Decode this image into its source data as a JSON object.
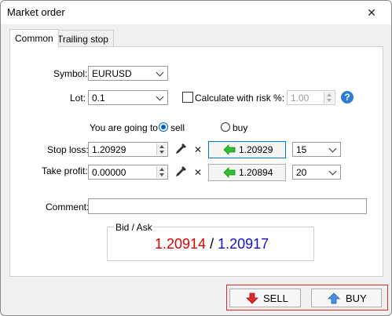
{
  "window": {
    "title": "Market order",
    "close_symbol": "✕"
  },
  "tabs": [
    {
      "label": "Common",
      "active": true
    },
    {
      "label": "Trailing stop",
      "active": false
    }
  ],
  "form": {
    "symbol": {
      "label": "Symbol:",
      "value": "EURUSD"
    },
    "lot": {
      "label": "Lot:",
      "value": "0.1"
    },
    "risk": {
      "label": "Calculate with risk %:",
      "checked": false,
      "value": "1.00",
      "help": "?"
    },
    "direction": {
      "label": "You are going to",
      "options": [
        {
          "label": "sell",
          "selected": true
        },
        {
          "label": "buy",
          "selected": false
        }
      ]
    },
    "stop_loss": {
      "label": "Stop loss:",
      "value": "1.20929",
      "clear": "✕",
      "price_button": "1.20929",
      "points": "15"
    },
    "take_profit": {
      "label": "Take profit:",
      "value": "0.00000",
      "clear": "✕",
      "price_button": "1.20894",
      "points": "20"
    },
    "comment": {
      "label": "Comment:",
      "value": ""
    }
  },
  "quote": {
    "title": "Bid / Ask",
    "bid": "1.20914",
    "separator": "/",
    "ask": "1.20917",
    "bid_color": "#e00000",
    "ask_color": "#1010d0"
  },
  "actions": {
    "sell_label": "SELL",
    "buy_label": "BUY"
  },
  "colors": {
    "arrow_green": "#2fbf2f",
    "sell_red": "#e02a2a",
    "buy_blue": "#4a90e2",
    "highlight_frame": "#e02a2a"
  }
}
